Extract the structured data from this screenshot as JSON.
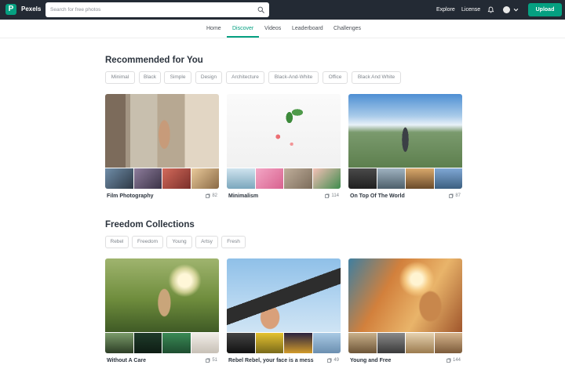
{
  "header": {
    "logo_letter": "P",
    "brand": "Pexels",
    "search_placeholder": "Search for free photos",
    "links": [
      "Explore",
      "License"
    ],
    "upload_label": "Upload"
  },
  "tabs": [
    "Home",
    "Discover",
    "Videos",
    "Leaderboard",
    "Challenges"
  ],
  "active_tab": "Discover",
  "recommended": {
    "title": "Recommended for You",
    "chips": [
      "Minimal",
      "Black",
      "Simple",
      "Design",
      "Architecture",
      "Black-And-White",
      "Office",
      "Black And White"
    ],
    "cards": [
      {
        "title": "Film Photography",
        "count": "82"
      },
      {
        "title": "Minimalism",
        "count": "114"
      },
      {
        "title": "On Top Of The World",
        "count": "87"
      }
    ]
  },
  "freedom": {
    "title": "Freedom Collections",
    "chips": [
      "Rebel",
      "Freedom",
      "Young",
      "Artsy",
      "Fresh"
    ],
    "cards": [
      {
        "title": "Without A Care",
        "count": "51"
      },
      {
        "title": "Rebel Rebel, your face is a mess",
        "count": "49"
      },
      {
        "title": "Young and Free",
        "count": "144"
      }
    ]
  },
  "colors": {
    "topbar": "#232a34",
    "accent": "#05a081"
  },
  "icons": [
    "search-icon",
    "bell-icon",
    "chevron-down-icon",
    "collection-stack-icon"
  ]
}
